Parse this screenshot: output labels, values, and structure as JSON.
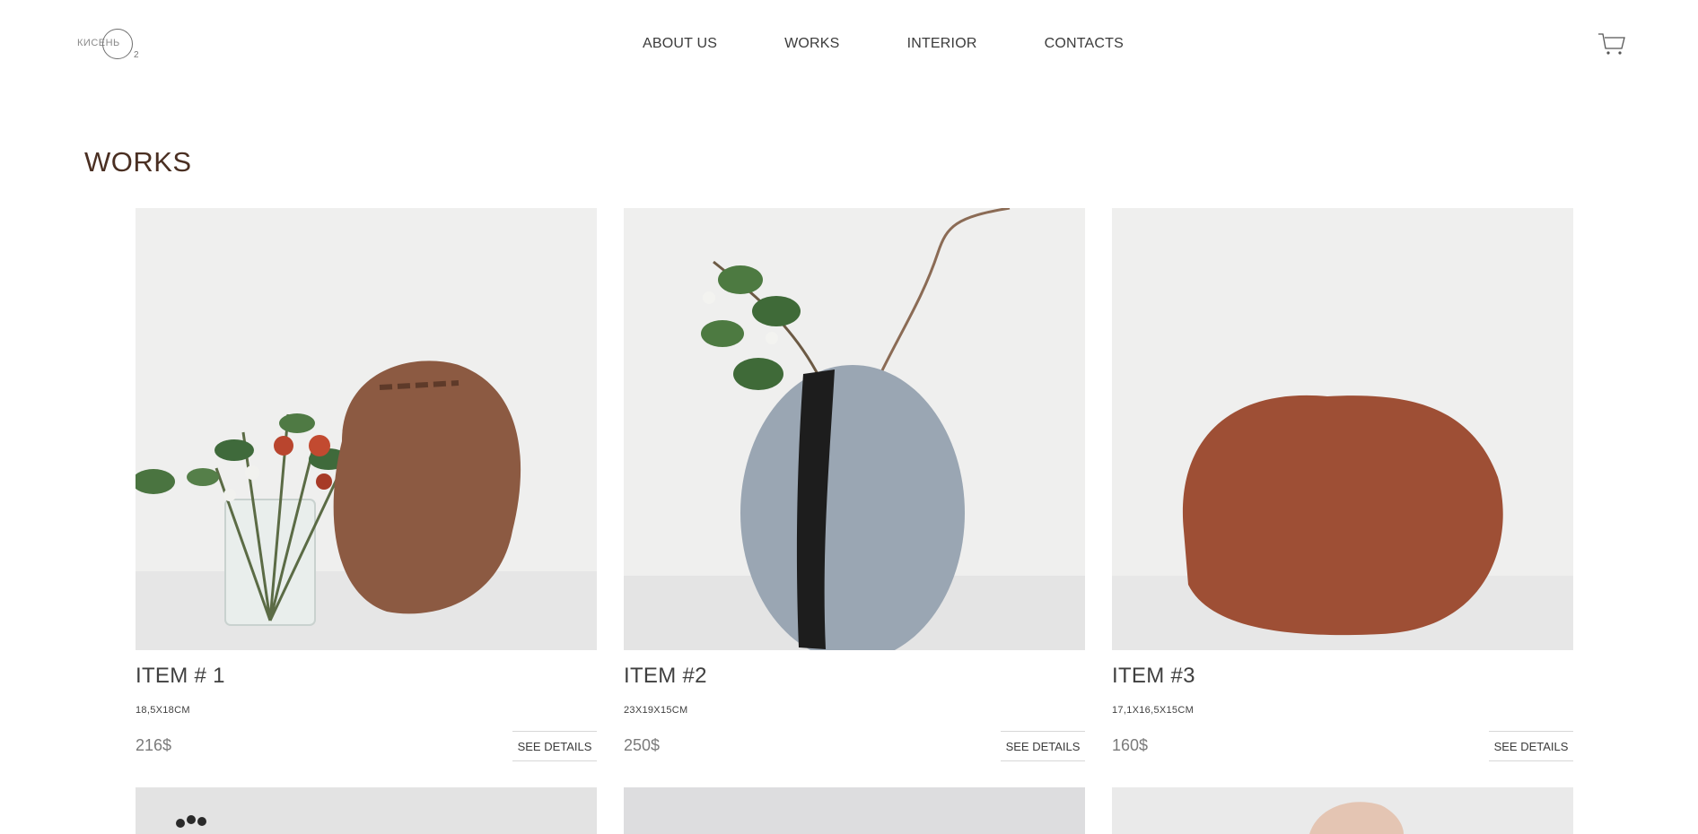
{
  "logo": {
    "text": "КИСЕНЬ",
    "sub": "2"
  },
  "nav": [
    {
      "label": "ABOUT US"
    },
    {
      "label": "WORKS"
    },
    {
      "label": "INTERIOR"
    },
    {
      "label": "CONTACTS"
    }
  ],
  "cart": {
    "icon": "cart-icon"
  },
  "page": {
    "title": "WORKS"
  },
  "items": [
    {
      "title": "ITEM # 1",
      "dims": "18,5X18CM",
      "price": "216$",
      "details": "SEE DETAILS"
    },
    {
      "title": "ITEM #2",
      "dims": "23X19X15CM",
      "price": "250$",
      "details": "SEE DETAILS"
    },
    {
      "title": "ITEM #3",
      "dims": "17,1X16,5X15CM",
      "price": "160$",
      "details": "SEE DETAILS"
    }
  ],
  "colors": {
    "title": "#4a2f22",
    "text": "#3f3f3f",
    "price": "#7a7a7a",
    "vase1": "#8c5a42",
    "vase2": "#9aa6b3",
    "vase3": "#9e4f35"
  }
}
